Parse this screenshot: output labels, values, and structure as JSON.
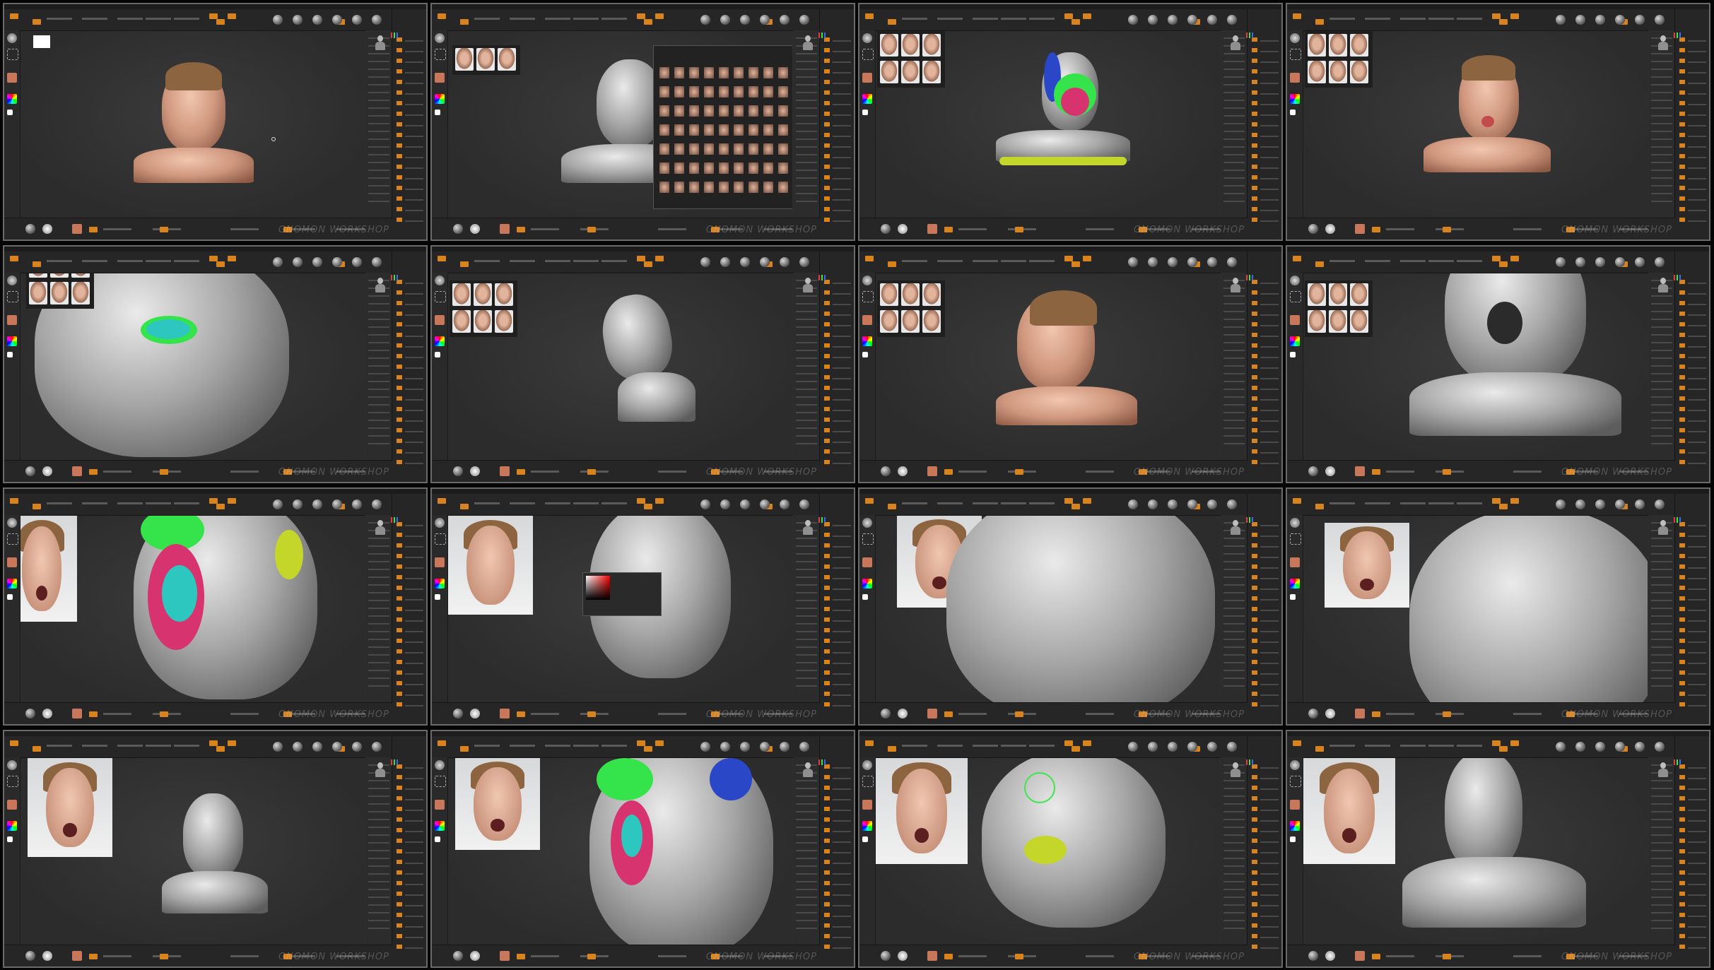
{
  "window": {
    "title": "",
    "watermark_text": "GNOMON WORKSHOP"
  },
  "colors": {
    "accent": "#d9831f",
    "panel_bg": "#262626",
    "canvas_bg": "#2e2e2e",
    "polygroup_green": "#35e34a",
    "polygroup_magenta": "#d6336f",
    "polygroup_cyan": "#2ec7c0",
    "polygroup_yellow": "#c5d62a",
    "polygroup_blue": "#2a47c8"
  },
  "tiles": [
    {
      "id": 1,
      "content": "textured-head-front"
    },
    {
      "id": 2,
      "content": "sculpt-head-with-reference-browser"
    },
    {
      "id": 3,
      "content": "polygroup-head-front"
    },
    {
      "id": 4,
      "content": "textured-head-tongue-out"
    },
    {
      "id": 5,
      "content": "detailed-scan-mouth-closeup"
    },
    {
      "id": 6,
      "content": "sculpt-head-profile"
    },
    {
      "id": 7,
      "content": "textured-head-three-quarter"
    },
    {
      "id": 8,
      "content": "sculpt-open-mouth-low-angle"
    },
    {
      "id": 9,
      "content": "polygroup-mouth-closeup"
    },
    {
      "id": 10,
      "content": "sculpt-forehead-with-colorpicker"
    },
    {
      "id": 11,
      "content": "sculpt-forehead-wrinkles-side"
    },
    {
      "id": 12,
      "content": "sculpt-forehead-wrinkles-closeup"
    },
    {
      "id": 13,
      "content": "sculpt-surprised-head"
    },
    {
      "id": 14,
      "content": "polygroup-surprised-closeup"
    },
    {
      "id": 15,
      "content": "sculpt-jaw-gizmo"
    },
    {
      "id": 16,
      "content": "sculpt-head-front-neutral"
    }
  ]
}
